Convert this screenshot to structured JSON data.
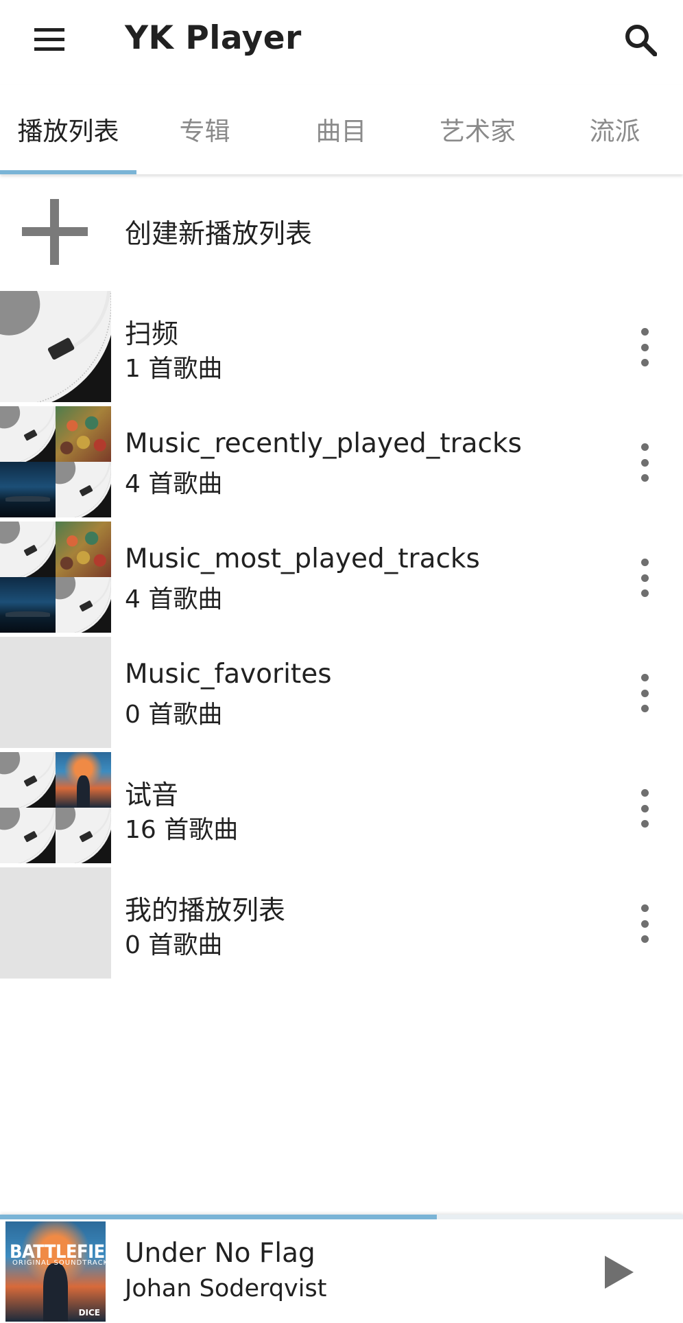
{
  "app_bar": {
    "title": "YK Player",
    "menu_icon": "hamburger-menu-icon",
    "search_icon": "search-icon"
  },
  "tabs": [
    {
      "label": "播放列表",
      "active": true
    },
    {
      "label": "专辑",
      "active": false
    },
    {
      "label": "曲目",
      "active": false
    },
    {
      "label": "艺术家",
      "active": false
    },
    {
      "label": "流派",
      "active": false
    }
  ],
  "create_playlist": {
    "icon": "plus-icon",
    "label": "创建新播放列表"
  },
  "playlists": [
    {
      "name": "扫频",
      "count": "1 首歌曲"
    },
    {
      "name": "Music_recently_played_tracks",
      "count": "4 首歌曲"
    },
    {
      "name": "Music_most_played_tracks",
      "count": "4 首歌曲"
    },
    {
      "name": "Music_favorites",
      "count": "0 首歌曲"
    },
    {
      "name": "试音",
      "count": "16 首歌曲"
    },
    {
      "name": "我的播放列表",
      "count": "0 首歌曲"
    }
  ],
  "now_playing": {
    "title": "Under No Flag",
    "artist": "Johan Soderqvist",
    "progress": 0.64,
    "art_text": "BATTLEFIELD V",
    "art_subtext": "ORIGINAL SOUNDTRACK",
    "art_badge": "DICE",
    "play_icon": "play-icon"
  },
  "colors": {
    "accent": "#7ab4d6",
    "placeholder_art": "#e3e3e3",
    "icon_gray": "#6f6f6f"
  }
}
